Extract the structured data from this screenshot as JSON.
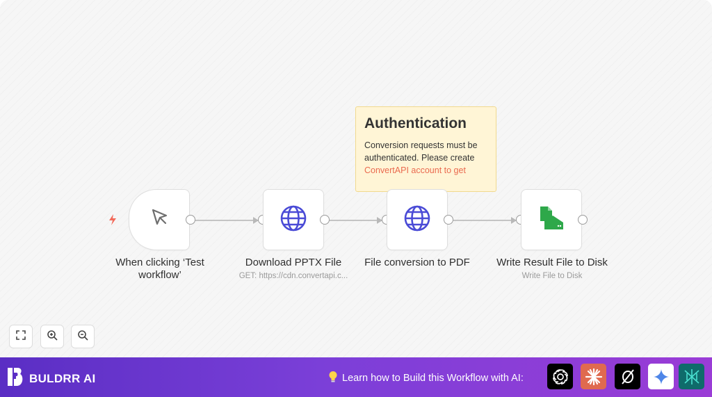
{
  "nodes": [
    {
      "label": "When clicking ‘Test workflow’",
      "icon": "cursor-icon"
    },
    {
      "label": "Download PPTX File",
      "subtitle": "GET: https://cdn.convertapi.c...",
      "icon": "globe-icon"
    },
    {
      "label": "File conversion to PDF",
      "icon": "globe-icon"
    },
    {
      "label": "Write Result File to Disk",
      "subtitle": "Write File to Disk",
      "icon": "file-disk-icon"
    }
  ],
  "sticky_note": {
    "title": "Authentication",
    "body": "Conversion requests must be authenticated. Please create",
    "link_text": "ConvertAPI account to get"
  },
  "footer": {
    "brand": "BULDRR AI",
    "cta": "Learn how to Build this Workflow with AI:",
    "ai_icons": [
      "openai-icon",
      "claude-icon",
      "perplexity-icon",
      "gemini-icon",
      "deepseek-icon"
    ]
  },
  "colors": {
    "accent_blue": "#4a4bd6",
    "trigger_bolt": "#f26b5b",
    "write_file_green": "#2ea84a",
    "footer_start": "#5a2ec4",
    "footer_end": "#9a3cd6",
    "sticky_bg": "#fff5d6",
    "sticky_link": "#ea6a4f"
  }
}
